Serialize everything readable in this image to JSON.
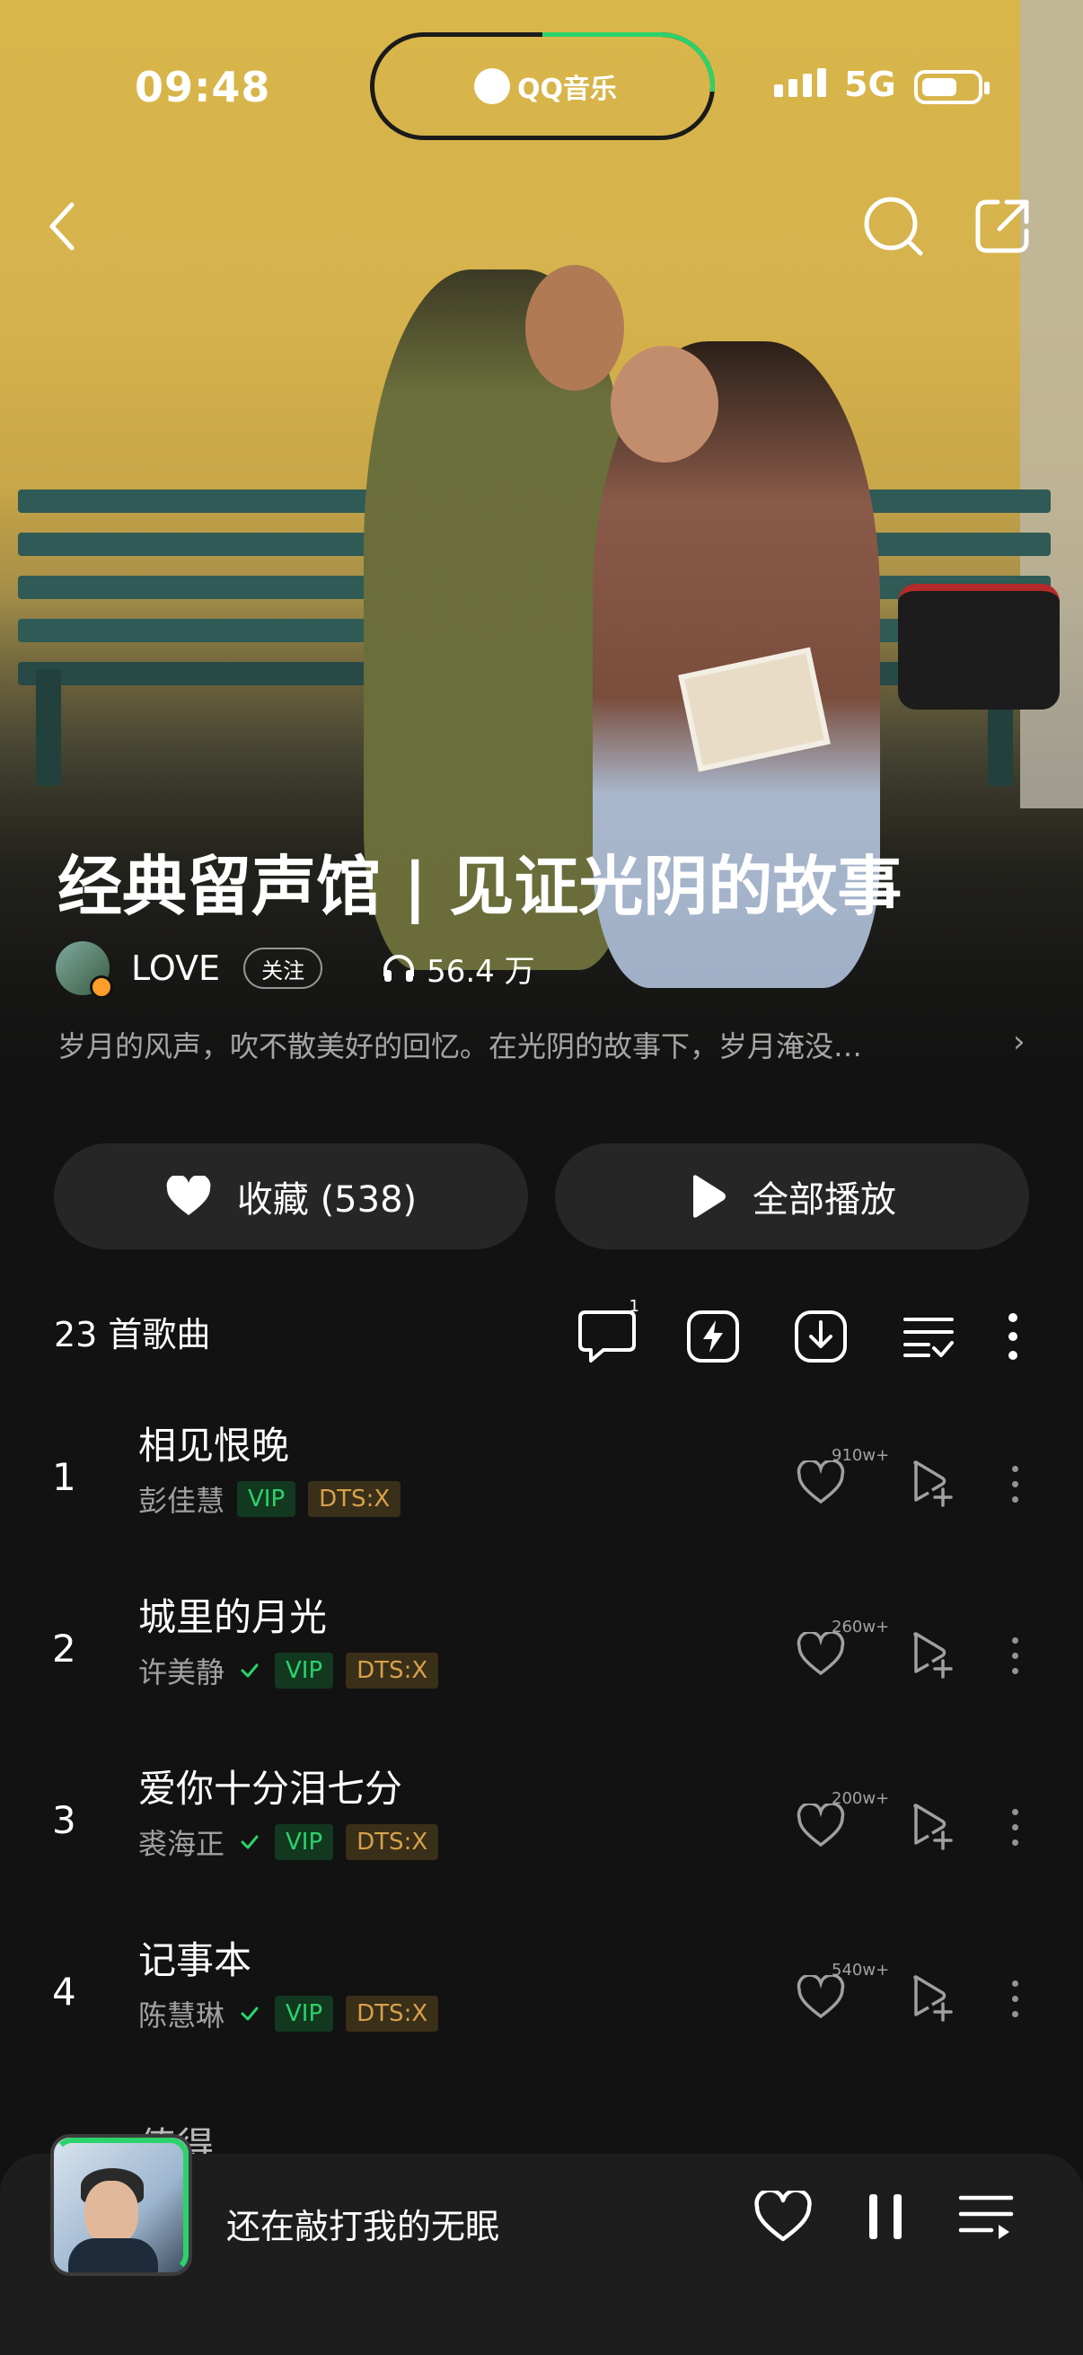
{
  "status_bar": {
    "time": "09:48",
    "island_app": "QQ音乐",
    "network": "5G"
  },
  "nav": {
    "back_icon": "chevron-left-icon",
    "search_icon": "search-icon",
    "share_icon": "share-icon"
  },
  "playlist": {
    "title": "经典留声馆 | 见证光阴的故事",
    "author": "LOVE",
    "follow_label": "关注",
    "play_count": "56.4 万",
    "description": "岁月的风声，吹不散美好的回忆。在光阴的故事下，岁月淹没…",
    "description_arrow": "›"
  },
  "actions": {
    "favorite_label": "收藏 (538)",
    "play_all_label": "全部播放"
  },
  "list": {
    "count_label": "23 首歌曲",
    "comment_count": "1"
  },
  "songs": [
    {
      "no": "1",
      "name": "相见恨晚",
      "artist": "彭佳慧",
      "verified": false,
      "vip": "VIP",
      "dts": "DTS:X",
      "likes": "910w+"
    },
    {
      "no": "2",
      "name": "城里的月光",
      "artist": "许美静",
      "verified": true,
      "vip": "VIP",
      "dts": "DTS:X",
      "likes": "260w+"
    },
    {
      "no": "3",
      "name": "爱你十分泪七分",
      "artist": "裘海正",
      "verified": true,
      "vip": "VIP",
      "dts": "DTS:X",
      "likes": "200w+"
    },
    {
      "no": "4",
      "name": "记事本",
      "artist": "陈慧琳",
      "verified": true,
      "vip": "VIP",
      "dts": "DTS:X",
      "likes": "540w+"
    }
  ],
  "partial_song": {
    "name": "值得"
  },
  "player": {
    "now_playing": "还在敲打我的无眠"
  },
  "colors": {
    "background": "#121212",
    "accent_green": "#2bd36b",
    "vip_bg": "#12381f",
    "dts_text": "#d7a24a",
    "button_bg": "#262626",
    "hero_yellow": "#d6b24c"
  }
}
